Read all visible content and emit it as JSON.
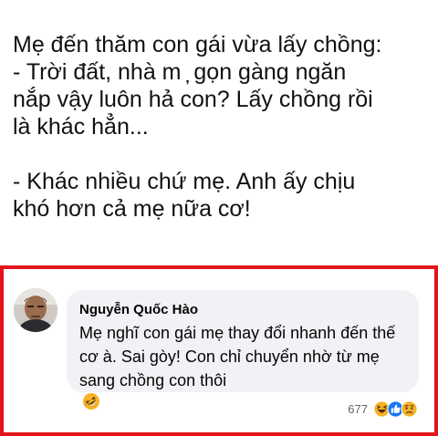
{
  "post": {
    "lines": [
      "Mẹ đến thăm con gái vừa lấy chồng:",
      "- Trời đất, nhà m  ̦  gọn gàng ngăn",
      "nắp vậy luôn hả con? Lấy chồng rồi",
      "là khác hẳn...",
      "- Khác nhiều chứ mẹ. Anh ấy chịu",
      "khó hơn cả mẹ nữa cơ!"
    ]
  },
  "comment": {
    "author": "Nguyễn Quốc Hào",
    "lines": [
      "Mẹ nghĩ con gái mẹ thay đổi nhanh đến thế",
      "cơ à. Sai gòy! Con chỉ chuyển nhờ từ mẹ",
      "sang chồng con thôi"
    ],
    "inline_emoji": "rolling-on-floor-laughing-icon",
    "reaction_count": "677",
    "reactions": [
      "haha-reaction-icon",
      "like-reaction-icon",
      "sad-reaction-icon"
    ]
  },
  "colors": {
    "highlight_border": "#e3141b",
    "bubble_bg": "#f0f2f5",
    "like_blue": "#1877f2",
    "reaction_yellow": "#f7b125"
  }
}
